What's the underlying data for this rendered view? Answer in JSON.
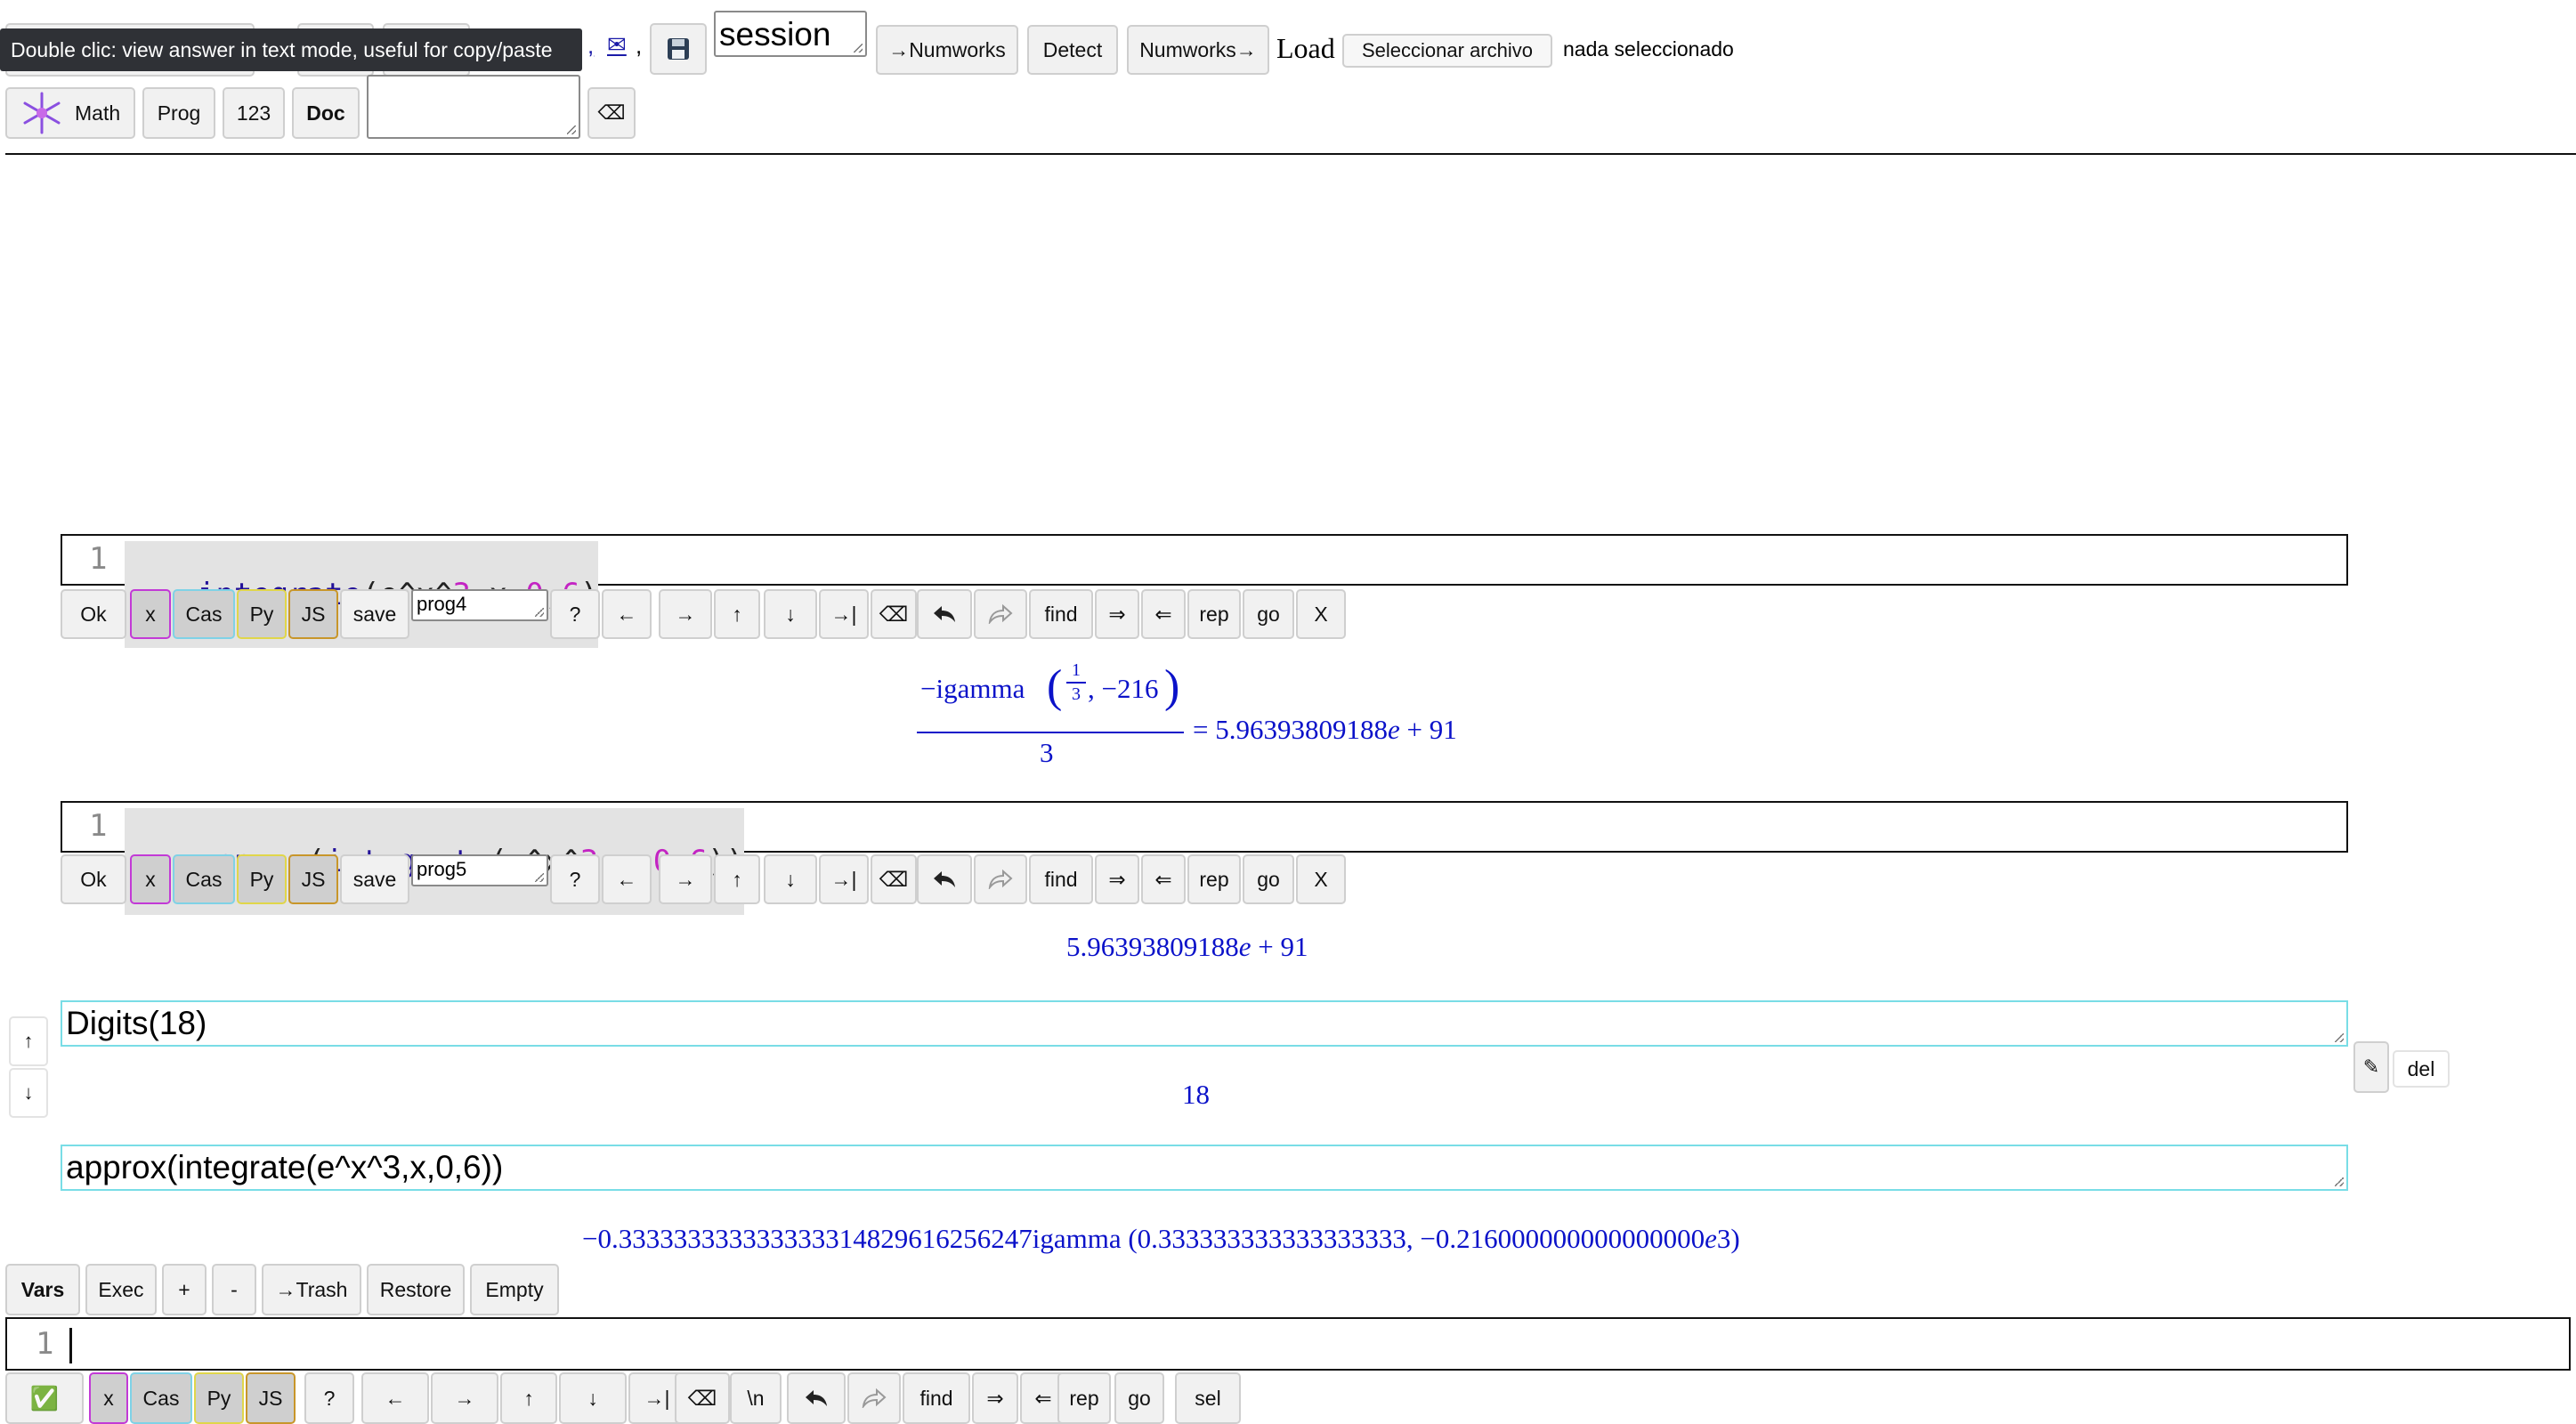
{
  "top": {
    "tooltip": "Double clic: view answer in text mode, useful for copy/paste",
    "link_fragment": ",",
    "mail_icon_text": "✉",
    "trailing_comma": ",",
    "session_field": "session",
    "to_numworks_label": "→Numworks",
    "detect_label": "Detect",
    "from_numworks_label": "Numworks→",
    "load_label": "Load",
    "file_button_label": "Seleccionar archivo",
    "file_status": "nada seleccionado",
    "math_label": "Math",
    "prog_label": "Prog",
    "num_label": "123",
    "doc_label": "Doc"
  },
  "prog4": {
    "line_number": "1",
    "code": {
      "fn": "integrate",
      "p1": "(e^x^",
      "n1": "3",
      "p2": ",x,",
      "n2": "0",
      "p3": ",",
      "n3": "6",
      "p4": ")"
    },
    "program_name": "prog4",
    "result": {
      "numerator_prefix": "−igamma",
      "frac_num": "1",
      "frac_den": "3",
      "args_rest": ", −216",
      "denominator": "3",
      "equals_value": "= 5.96393809188",
      "e_letter": "e",
      "exponent_part": " + 91"
    }
  },
  "prog5": {
    "line_number": "1",
    "code": {
      "fn1": "approx",
      "p0": "(",
      "fn2": "integrate",
      "p1": "(e^x^",
      "n1": "3",
      "p2": ",x,",
      "n2": "0",
      "p3": ",",
      "n3": "6",
      "p4": "))"
    },
    "program_name": "prog5",
    "result": {
      "value": "5.96393809188",
      "e_letter": "e",
      "rest": " + 91"
    }
  },
  "toolbar": {
    "ok": "Ok",
    "x": "x",
    "cas": "Cas",
    "py": "Py",
    "js": "JS",
    "save": "save",
    "help": "?",
    "left": "←",
    "right": "→",
    "up": "↑",
    "down": "↓",
    "tab": "→|",
    "backspace": "⌫",
    "find": "find",
    "next": "⇒",
    "prev": "⇐",
    "rep": "rep",
    "go": "go",
    "close": "X"
  },
  "cell_digits": {
    "input": "Digits(18)",
    "result": "18"
  },
  "cell_approx": {
    "input": "approx(integrate(e^x^3,x,0,6))",
    "result_prefix": "−0.333333333333333314829616256247igamma (0.333333333333333333, −0.216000000000000000",
    "result_e": "e",
    "result_suffix": "3)"
  },
  "side": {
    "up_arrow": "↑",
    "down_arrow": "↓",
    "edit_icon": "✎",
    "del": "del"
  },
  "bottom": {
    "vars": "Vars",
    "exec": "Exec",
    "plus": "+",
    "minus": "-",
    "trash": "→Trash",
    "restore": "Restore",
    "empty": "Empty",
    "line_number": "1",
    "check": "✅",
    "newline": "\\n",
    "sel": "sel"
  },
  "colors": {
    "result_blue": "#0b12c9",
    "keyword": "#221199",
    "number": "#c324c3"
  }
}
